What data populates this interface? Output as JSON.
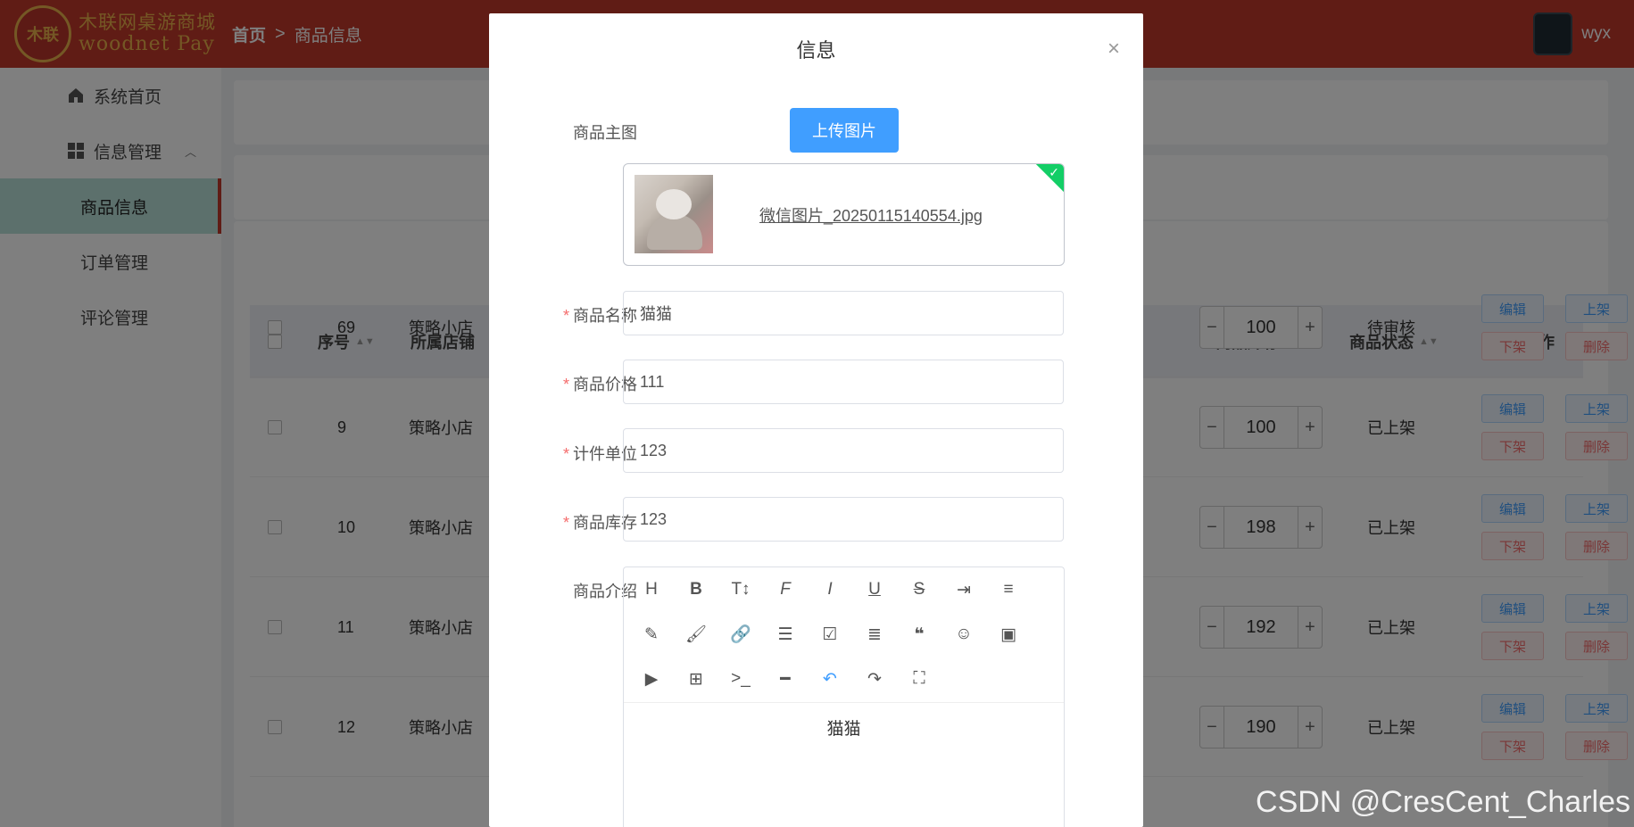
{
  "header": {
    "logo_seal": "木联",
    "logo_line1": "木联网桌游商城",
    "logo_line2": "woodnet Pay",
    "breadcrumb_home": "首页",
    "breadcrumb_sep": ">",
    "breadcrumb_current": "商品信息",
    "username": "wyx"
  },
  "sidebar": {
    "items": [
      {
        "label": "系统首页",
        "icon": "home-icon"
      },
      {
        "label": "信息管理",
        "icon": "grid-icon"
      },
      {
        "label": "商品信息"
      },
      {
        "label": "订单管理"
      },
      {
        "label": "评论管理"
      }
    ]
  },
  "table": {
    "headers": {
      "index": "序号",
      "shop": "所属店铺",
      "stock": "商品库存",
      "status": "商品状态",
      "actions": "操作"
    },
    "rows": [
      {
        "id": "69",
        "shop": "策略小店",
        "stock": "100",
        "status": "待审核"
      },
      {
        "id": "9",
        "shop": "策略小店",
        "stock": "100",
        "status": "已上架"
      },
      {
        "id": "10",
        "shop": "策略小店",
        "stock": "198",
        "status": "已上架"
      },
      {
        "id": "11",
        "shop": "策略小店",
        "stock": "192",
        "status": "已上架"
      },
      {
        "id": "12",
        "shop": "策略小店",
        "stock": "190",
        "status": "已上架"
      }
    ],
    "actions": {
      "edit": "编辑",
      "list": "上架",
      "unlist": "下架",
      "delete": "删除"
    },
    "stepper_minus": "−",
    "stepper_plus": "+"
  },
  "dialog": {
    "title": "信息",
    "close": "×",
    "main_image_label": "商品主图",
    "upload_button": "上传图片",
    "file_name": "微信图片_20250115140554.jpg",
    "name_label": "商品名称",
    "name_value": "猫猫",
    "price_label": "商品价格",
    "price_value": "111",
    "unit_label": "计件单位",
    "unit_value": "123",
    "stock_label": "商品库存",
    "stock_value": "123",
    "intro_label": "商品介绍",
    "required_mark": "*",
    "editor_content": "猫猫"
  },
  "watermark": "CSDN @CresCent_Charles",
  "colors": {
    "header": "#c0392b",
    "primary": "#409eff",
    "danger": "#f56c6c",
    "success": "#13ce66",
    "active_menu": "#b8e0d8"
  }
}
